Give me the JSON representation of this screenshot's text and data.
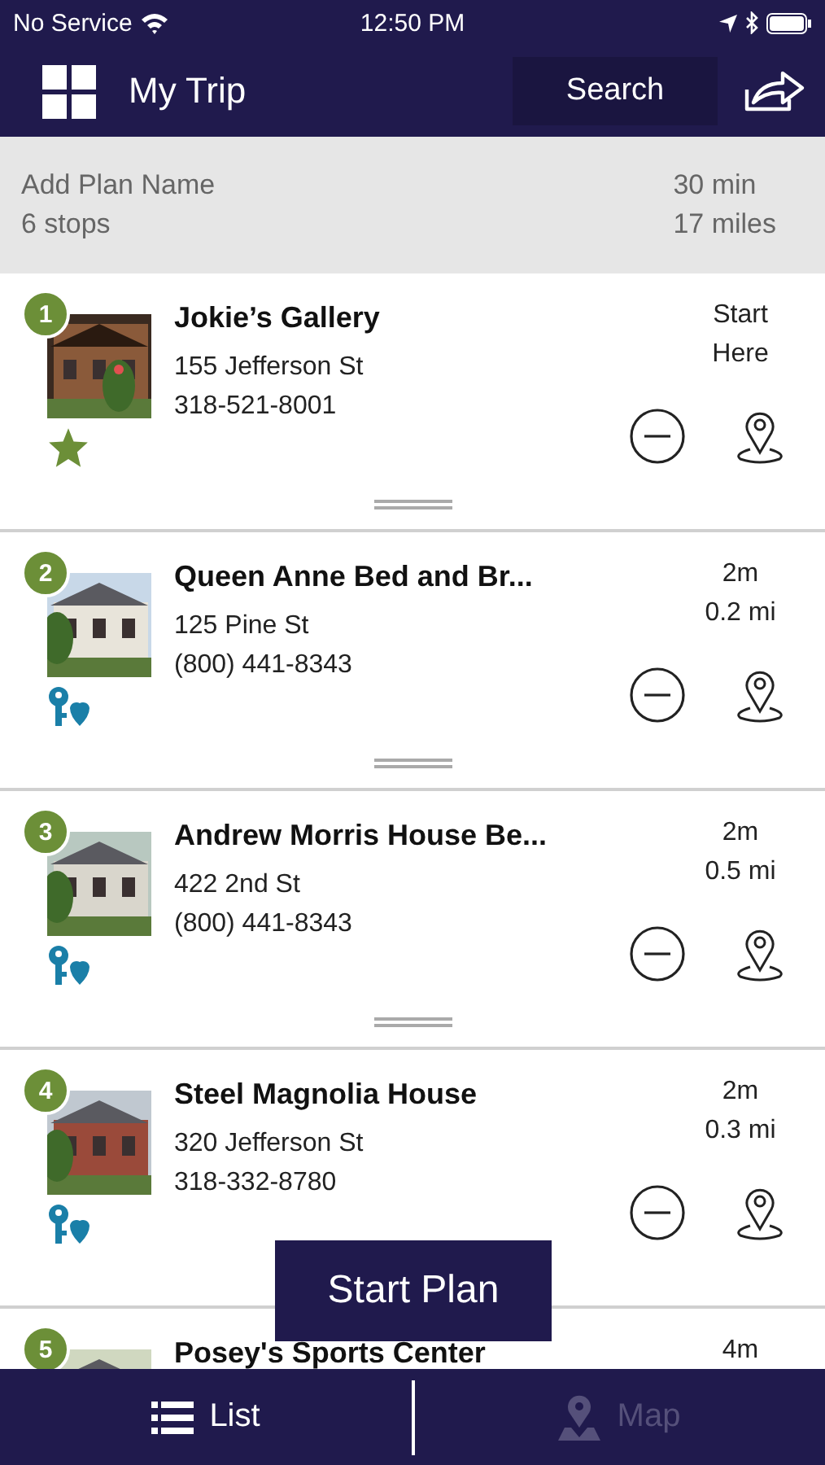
{
  "status_bar": {
    "carrier": "No Service",
    "time": "12:50 PM"
  },
  "header": {
    "title": "My Trip",
    "search_label": "Search"
  },
  "summary": {
    "plan_name_placeholder": "Add Plan Name",
    "stops": "6 stops",
    "duration": "30 min",
    "distance": "17 miles"
  },
  "stops": [
    {
      "number": "1",
      "name": "Jokie’s Gallery",
      "address": "155 Jefferson St",
      "phone": "318-521-8001",
      "info": [
        "Start Here"
      ],
      "kind": "favorite"
    },
    {
      "number": "2",
      "name": "Queen Anne Bed and Br...",
      "address": "125 Pine St",
      "phone": "(800) 441-8343",
      "info": [
        "2m",
        "0.2 mi"
      ],
      "kind": "lodging"
    },
    {
      "number": "3",
      "name": "Andrew Morris House Be...",
      "address": "422 2nd St",
      "phone": "(800) 441-8343",
      "info": [
        "2m",
        "0.5 mi"
      ],
      "kind": "lodging"
    },
    {
      "number": "4",
      "name": "Steel Magnolia House",
      "address": "320 Jefferson St",
      "phone": "318-332-8780",
      "info": [
        "2m",
        "0.3 mi"
      ],
      "kind": "lodging"
    },
    {
      "number": "5",
      "name": "Posey's Sports Center",
      "info": [
        "4m"
      ],
      "kind": "none"
    }
  ],
  "start_button": "Start Plan",
  "tabs": [
    {
      "label": "List",
      "kind": "list",
      "selected": true
    },
    {
      "label": "Map",
      "kind": "map",
      "selected": false
    }
  ]
}
